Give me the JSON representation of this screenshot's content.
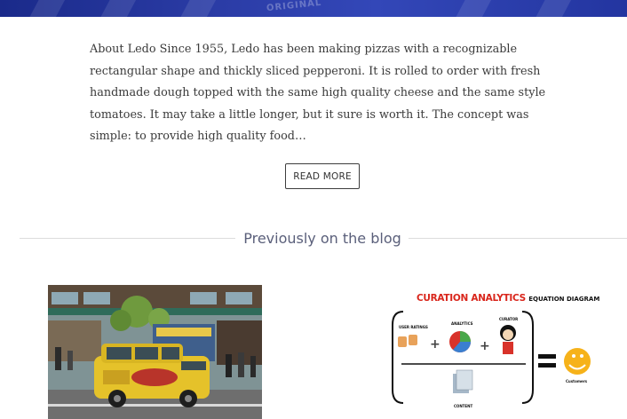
{
  "about": {
    "text": "About Ledo Since 1955, Ledo has been making pizzas with a recognizable rectangular shape and thickly sliced pepperoni. It is rolled to order with fresh handmade dough topped with the same high quality cheese and the same style tomatoes. It may take a little longer, but it sure is worth it. The concept was simple: to provide high quality food…",
    "read_more_label": "READ MORE"
  },
  "banner": {
    "word": "ORIGINAL"
  },
  "blog": {
    "heading": "Previously on the blog",
    "posts": [
      {
        "image_icon": "ledo-pizza-car-photo"
      },
      {
        "image_icon": "curation-analytics-diagram",
        "diagram": {
          "title_main": "CURATION ANALYTICS",
          "title_small": "EQUATION DIAGRAM",
          "labels": {
            "user_ratings": "USER RATINGS",
            "analytics": "ANALYTICS",
            "curator": "CURATOR",
            "content": "CONTENT",
            "customers": "Customers"
          }
        }
      }
    ]
  },
  "colors": {
    "banner": "#2b3ca6",
    "heading": "#5a5f7a",
    "text": "#3a3a3a",
    "diagram_title": "#d9261c"
  }
}
